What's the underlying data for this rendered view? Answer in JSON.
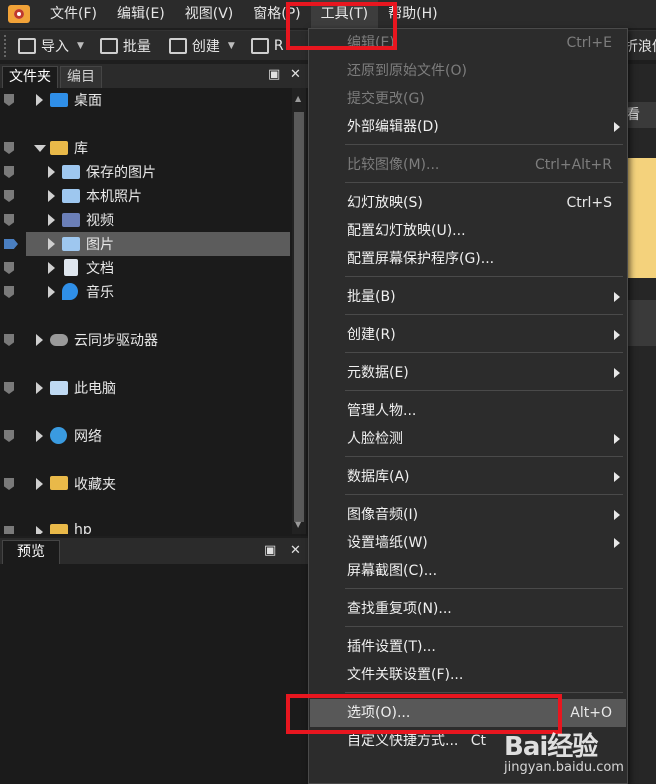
{
  "menubar": {
    "items": [
      {
        "label": "文件(F)"
      },
      {
        "label": "编辑(E)"
      },
      {
        "label": "视图(V)"
      },
      {
        "label": "窗格(P)"
      },
      {
        "label": "工具(T)"
      },
      {
        "label": "帮助(H)"
      }
    ]
  },
  "toolbar": {
    "import_label": "导入",
    "batch_label": "批量",
    "create_label": "创建",
    "overflow_label": "R",
    "truncated_right": "折浪倡"
  },
  "folders_panel": {
    "tabs": [
      {
        "label": "文件夹"
      },
      {
        "label": "编目"
      }
    ],
    "pin_glyph": "📌",
    "close_glyph": "✕",
    "tree": [
      {
        "label": "桌面"
      },
      {
        "label": "库"
      },
      {
        "label": "保存的图片"
      },
      {
        "label": "本机照片"
      },
      {
        "label": "视频"
      },
      {
        "label": "图片"
      },
      {
        "label": "文档"
      },
      {
        "label": "音乐"
      },
      {
        "label": "云同步驱动器"
      },
      {
        "label": "此电脑"
      },
      {
        "label": "网络"
      },
      {
        "label": "收藏夹"
      },
      {
        "label": "hp"
      }
    ]
  },
  "preview_panel": {
    "title": "预览"
  },
  "content": {
    "tab_fragment": "看"
  },
  "tools_menu": {
    "items": [
      {
        "label": "编辑(E)",
        "shortcut": "Ctrl+E"
      },
      {
        "label": "还原到原始文件(O)"
      },
      {
        "label": "提交更改(G)"
      },
      {
        "label": "外部编辑器(D)"
      },
      {
        "label": "比较图像(M)...",
        "shortcut": "Ctrl+Alt+R"
      },
      {
        "label": "幻灯放映(S)",
        "shortcut": "Ctrl+S"
      },
      {
        "label": "配置幻灯放映(U)..."
      },
      {
        "label": "配置屏幕保护程序(G)..."
      },
      {
        "label": "批量(B)"
      },
      {
        "label": "创建(R)"
      },
      {
        "label": "元数据(E)"
      },
      {
        "label": "管理人物..."
      },
      {
        "label": "人脸检测"
      },
      {
        "label": "数据库(A)"
      },
      {
        "label": "图像音频(I)"
      },
      {
        "label": "设置墙纸(W)"
      },
      {
        "label": "屏幕截图(C)..."
      },
      {
        "label": "查找重复项(N)..."
      },
      {
        "label": "插件设置(T)..."
      },
      {
        "label": "文件关联设置(F)..."
      },
      {
        "label": "选项(O)...",
        "shortcut": "Alt+O"
      },
      {
        "label": "自定义快捷方式...",
        "shortcut": "Ct"
      }
    ]
  },
  "watermark": {
    "logo": "Bai经验",
    "url": "jingyan.baidu.com"
  },
  "colors": {
    "highlight_box": "#e8161f",
    "menu_bg": "#2c2c2c",
    "selected_row": "#5c5c5c",
    "accent_yellow": "#f4d27c"
  }
}
